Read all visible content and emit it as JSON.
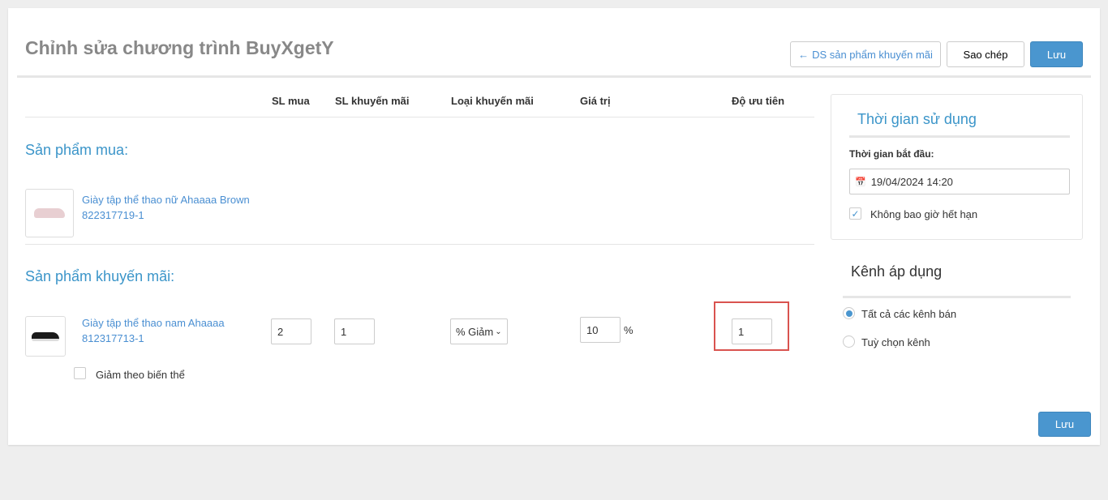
{
  "page": {
    "title": "Chỉnh sửa chương trình BuyXgetY"
  },
  "toolbar": {
    "back_label": "DS sản phẩm khuyến mãi",
    "copy_label": "Sao chép",
    "save_label": "Lưu"
  },
  "table": {
    "headers": [
      "SL mua",
      "SL khuyến mãi",
      "Loại khuyến mãi",
      "Giá trị",
      "Độ ưu tiên"
    ]
  },
  "buy": {
    "section_title": "Sản phẩm mua:",
    "product": {
      "name": "Giày tập thể thao nữ Ahaaaa Brown",
      "sku": "822317719-1"
    }
  },
  "promo": {
    "section_title": "Sản phẩm khuyến mãi:",
    "product": {
      "name": "Giày tập thể thao nam Ahaaaa",
      "sku": "812317713-1"
    },
    "buy_qty": "2",
    "promo_qty": "1",
    "promo_type": "% Giảm",
    "value": "10",
    "value_unit": "%",
    "priority": "1",
    "variant_label": "Giảm theo biến thể"
  },
  "time": {
    "title": "Thời gian sử dụng",
    "start_label": "Thời gian bắt đầu:",
    "start_value": "19/04/2024 14:20",
    "never_expire_label": "Không bao giờ hết hạn"
  },
  "channel": {
    "title": "Kênh áp dụng",
    "options": [
      "Tất cả các kênh bán",
      "Tuỳ chọn kênh"
    ]
  },
  "footer": {
    "save_label": "Lưu"
  },
  "colors": {
    "accent": "#4a96cf",
    "highlight": "#d9534f"
  }
}
